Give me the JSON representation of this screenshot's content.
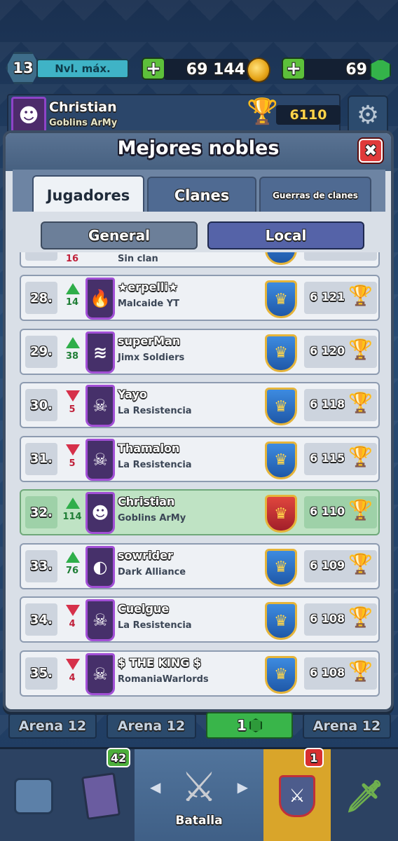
{
  "top": {
    "level": "13",
    "level_label": "Nvl. máx.",
    "gold": "69 144",
    "gems": "69",
    "plus": "+"
  },
  "profile": {
    "name": "Christian",
    "clan": "Goblins ArMy",
    "trophies": "6110"
  },
  "panel": {
    "title": "Mejores nobles",
    "close": "✖",
    "tabs": [
      "Jugadores",
      "Clanes",
      "Guerras de clanes"
    ],
    "subtabs": [
      "General",
      "Local"
    ],
    "partial_row": {
      "rank": "",
      "change": "16",
      "clan": "Sin clan"
    }
  },
  "rows": [
    {
      "rank": "28.",
      "dir": "up",
      "change": "14",
      "name": "★erpelli★",
      "clan": "Malcaide YT",
      "trophies": "6 121",
      "badge_icon": "flame-icon",
      "arena_color": "#3d8be0"
    },
    {
      "rank": "29.",
      "dir": "up",
      "change": "38",
      "name": "superMan",
      "clan": "Jimx Soldiers",
      "trophies": "6 120",
      "badge_icon": "chevrons-icon",
      "arena_color": "#3d8be0"
    },
    {
      "rank": "30.",
      "dir": "down",
      "change": "5",
      "name": "Yayo",
      "clan": "La Resistencia",
      "trophies": "6 118",
      "badge_icon": "skull-icon",
      "arena_color": "#3d8be0"
    },
    {
      "rank": "31.",
      "dir": "down",
      "change": "5",
      "name": "Thamalon",
      "clan": "La Resistencia",
      "trophies": "6 115",
      "badge_icon": "skull-icon",
      "arena_color": "#3d8be0"
    },
    {
      "rank": "32.",
      "dir": "up",
      "change": "114",
      "name": "Christian",
      "clan": "Goblins ArMy",
      "trophies": "6 110",
      "badge_icon": "goblin-icon",
      "arena_color": "#e0463d",
      "me": true
    },
    {
      "rank": "33.",
      "dir": "up",
      "change": "76",
      "name": "sowrider",
      "clan": "Dark Alliance",
      "trophies": "6 109",
      "badge_icon": "moon-icon",
      "arena_color": "#3d8be0"
    },
    {
      "rank": "34.",
      "dir": "down",
      "change": "4",
      "name": "Cuelgue",
      "clan": "La Resistencia",
      "trophies": "6 108",
      "badge_icon": "skull-icon",
      "arena_color": "#3d8be0"
    },
    {
      "rank": "35.",
      "dir": "down",
      "change": "4",
      "name": "$ THE KING $",
      "clan": "RomaniaWarlords",
      "trophies": "6 108",
      "badge_icon": "skull-icon",
      "arena_color": "#3d8be0"
    }
  ],
  "bottom": {
    "arena_label": "Arena 12",
    "gem_cost": "1",
    "cards_badge": "42",
    "clan_badge": "1",
    "battle_label": "Batalla"
  },
  "colors": {
    "up": "#2fae4a",
    "down": "#d6304a",
    "me_row": "#bfe3c4"
  }
}
